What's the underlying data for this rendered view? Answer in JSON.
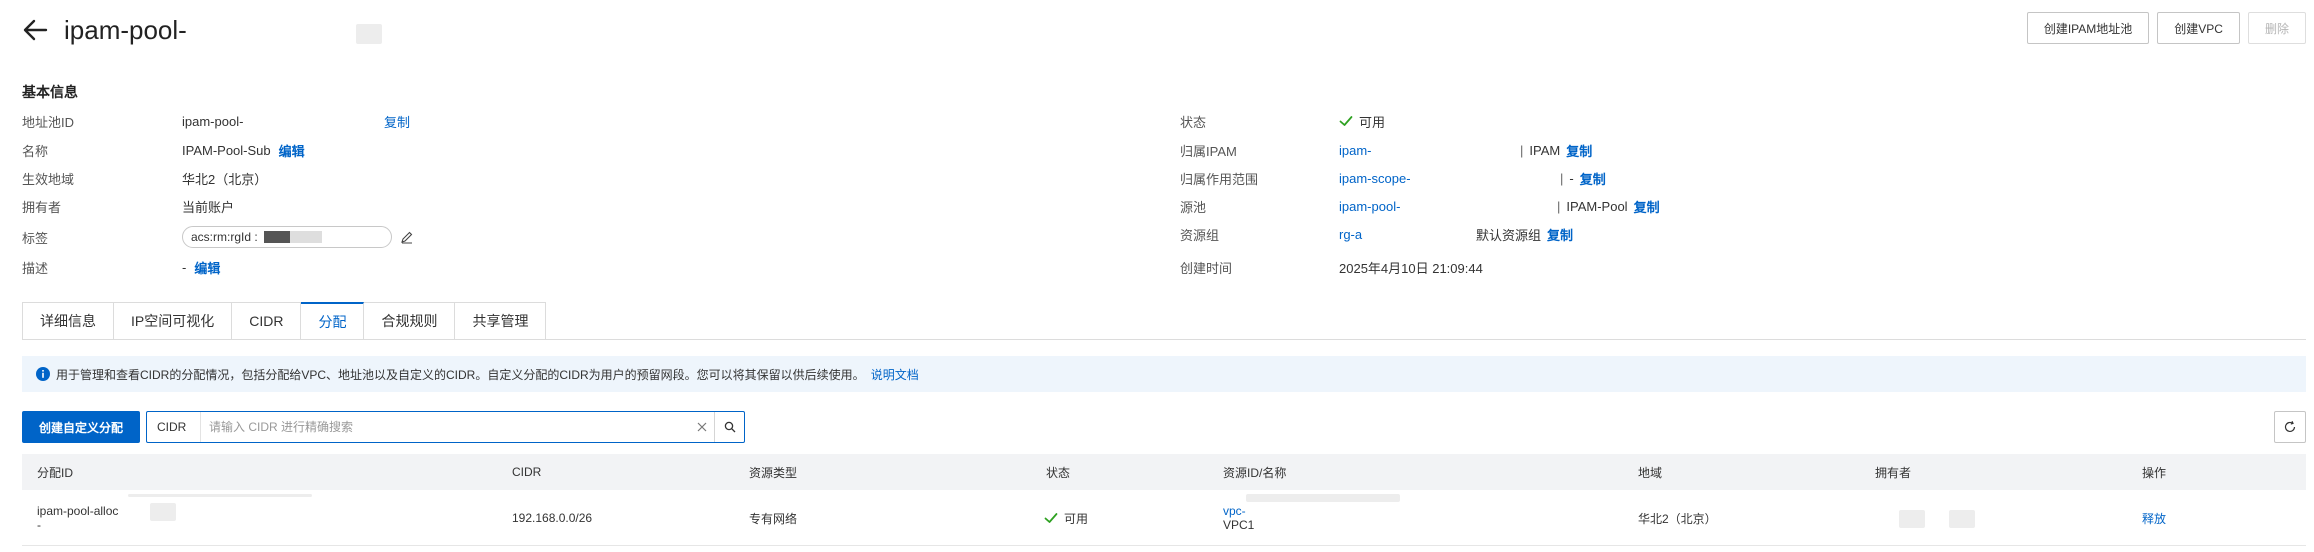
{
  "header": {
    "title": "ipam-pool-"
  },
  "actions": {
    "create_pool": "创建IPAM地址池",
    "create_vpc": "创建VPC",
    "delete": "删除"
  },
  "basic_info": {
    "title": "基本信息",
    "left": [
      {
        "label": "地址池ID",
        "value": "ipam-pool-",
        "action": "复制"
      },
      {
        "label": "名称",
        "value": "IPAM-Pool-Sub",
        "action": "编辑"
      },
      {
        "label": "生效地域",
        "value": "华北2（北京）"
      },
      {
        "label": "拥有者",
        "value": "当前账户"
      },
      {
        "label": "标签",
        "value": "acs:rm:rgId :"
      },
      {
        "label": "描述",
        "value": "-",
        "action": "编辑"
      }
    ],
    "right": [
      {
        "label": "状态",
        "value": "可用"
      },
      {
        "label": "归属IPAM",
        "value": "ipam-",
        "suffix": "IPAM",
        "action": "复制"
      },
      {
        "label": "归属作用范围",
        "value": "ipam-scope-",
        "suffix": "-",
        "action": "复制"
      },
      {
        "label": "源池",
        "value": "ipam-pool-",
        "suffix": "IPAM-Pool",
        "action": "复制"
      },
      {
        "label": "资源组",
        "value": "rg-a",
        "suffix": "默认资源组",
        "action": "复制"
      },
      {
        "label": "创建时间",
        "value": "2025年4月10日 21:09:44"
      }
    ]
  },
  "tabs": [
    "详细信息",
    "IP空间可视化",
    "CIDR",
    "分配",
    "合规规则",
    "共享管理"
  ],
  "notice": {
    "text": "用于管理和查看CIDR的分配情况，包括分配给VPC、地址池以及自定义的CIDR。自定义分配的CIDR为用户的预留网段。您可以将其保留以供后续使用。",
    "link": "说明文档"
  },
  "toolbar": {
    "create_custom": "创建自定义分配",
    "search_field": "CIDR",
    "search_placeholder": "请输入 CIDR 进行精确搜索"
  },
  "table": {
    "columns": [
      "分配ID",
      "CIDR",
      "资源类型",
      "状态",
      "资源ID/名称",
      "地域",
      "拥有者",
      "操作"
    ],
    "rows": [
      {
        "alloc_id": "ipam-pool-alloc",
        "alloc_id_line2": "-",
        "cidr": "192.168.0.0/26",
        "resource_type": "专有网络",
        "status": "可用",
        "resource_id": "vpc-",
        "resource_name": "VPC1",
        "region": "华北2（北京）",
        "operation": "释放"
      }
    ]
  },
  "colors": {
    "accent": "#0064c8",
    "success": "#2ea121"
  }
}
